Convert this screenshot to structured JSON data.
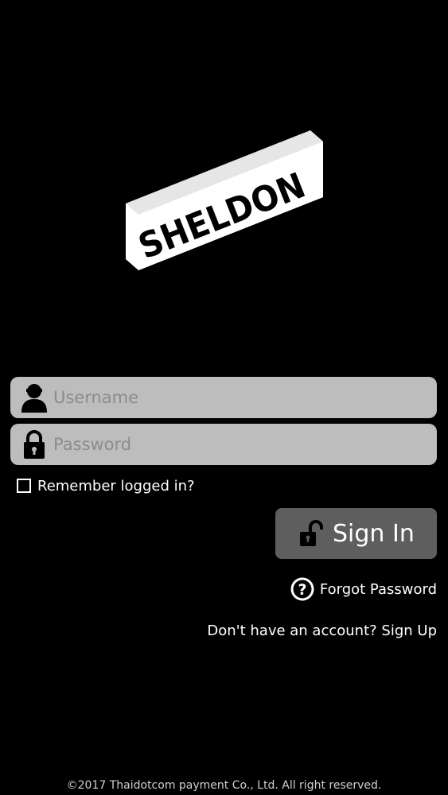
{
  "logo": {
    "text": "SHELDON"
  },
  "login_form": {
    "username_placeholder": "Username",
    "password_placeholder": "Password",
    "remember_label": "Remember logged in?",
    "remember_checked": false,
    "signin_label": "Sign In",
    "forgot_label": "Forgot Password",
    "signup_label": "Don't have an account? Sign Up"
  },
  "icons": {
    "username": "user-icon",
    "password": "lock-icon",
    "signin": "unlock-icon",
    "forgot": "question-circle-icon"
  },
  "footer": {
    "copyright": "©2017 Thaidotcom payment Co., Ltd. All right reserved."
  },
  "colors": {
    "background": "#000000",
    "field_background": "#bdbdbd",
    "button_background": "#5e5e5e",
    "text": "#ffffff"
  }
}
